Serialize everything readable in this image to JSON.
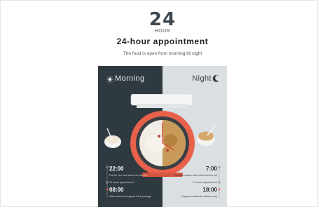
{
  "header": {
    "big_number": "24",
    "hour_label": "HOUR",
    "title": "24-hour appointment",
    "subtitle": "The food is open from morning till night"
  },
  "poster": {
    "morning_label": "Morning",
    "night_label": "Night",
    "left_schedule": [
      {
        "time": "22:00",
        "desc": "Put the rice and water into the pot"
      },
      {
        "desc": "10 hours appointment"
      },
      {
        "time": "08:00",
        "desc": "Warm stomach fragrant thick porridge"
      }
    ],
    "right_schedule": [
      {
        "time": "7:00",
        "desc": "Put the chicken and herbs into the pot"
      },
      {
        "desc": "11 hours appointment"
      },
      {
        "time": "18:00",
        "desc": "Fragrant medicinal chicken soup"
      }
    ]
  },
  "colors": {
    "left_panel": "#2f3940",
    "right_panel": "#dadfe2",
    "accent": "#e8614a"
  }
}
